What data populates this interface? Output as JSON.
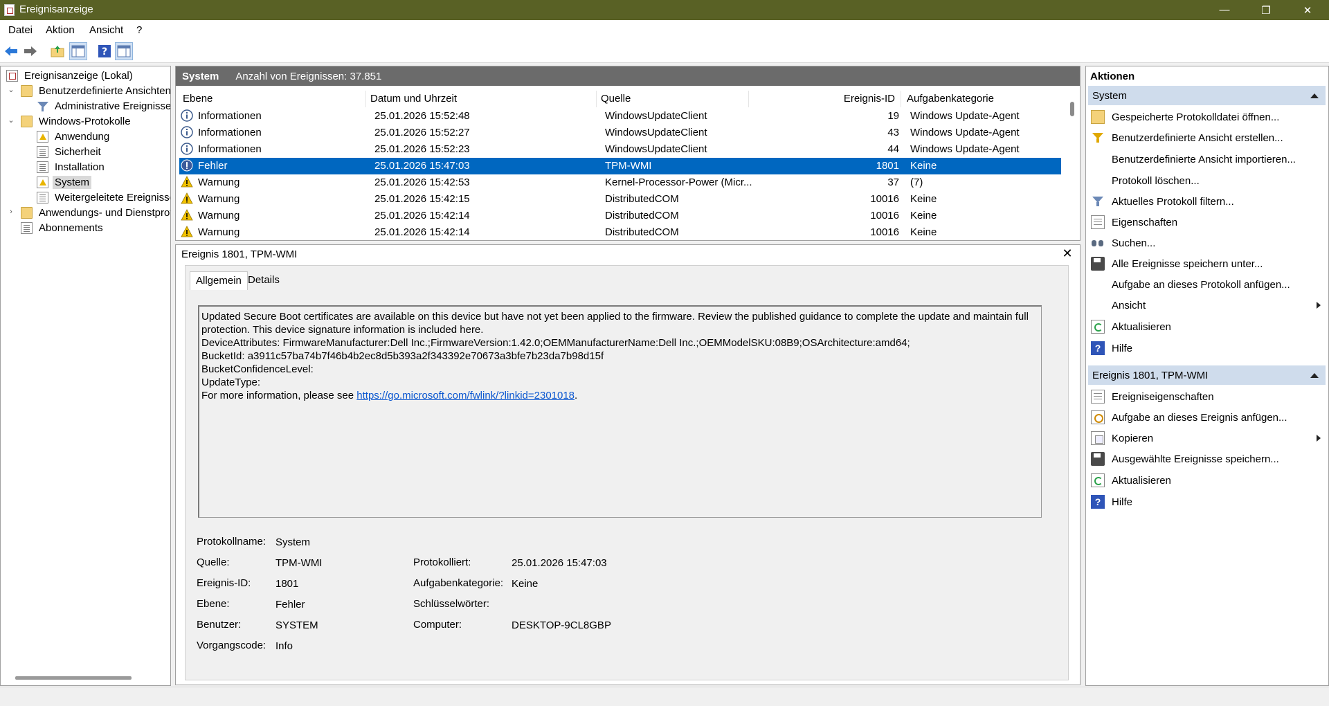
{
  "window": {
    "title": "Ereignisanzeige"
  },
  "menu": [
    "Datei",
    "Aktion",
    "Ansicht",
    "?"
  ],
  "tree": {
    "root": "Ereignisanzeige (Lokal)",
    "custom_views": "Benutzerdefinierte Ansichten",
    "admin_events": "Administrative Ereignisse",
    "windows_logs": "Windows-Protokolle",
    "logs": [
      "Anwendung",
      "Sicherheit",
      "Installation",
      "System",
      "Weitergeleitete Ereignisse"
    ],
    "app_services": "Anwendungs- und Dienstprotokolle",
    "subscriptions": "Abonnements"
  },
  "list": {
    "title": "System",
    "count": "Anzahl von Ereignissen: 37.851",
    "columns": [
      "Ebene",
      "Datum und Uhrzeit",
      "Quelle",
      "Ereignis-ID",
      "Aufgabenkategorie"
    ],
    "rows": [
      {
        "level": "Informationen",
        "icon": "info-icon",
        "date": "25.01.2026 15:52:48",
        "source": "WindowsUpdateClient",
        "id": "19",
        "task": "Windows Update-Agent"
      },
      {
        "level": "Informationen",
        "icon": "info-icon",
        "date": "25.01.2026 15:52:27",
        "source": "WindowsUpdateClient",
        "id": "43",
        "task": "Windows Update-Agent"
      },
      {
        "level": "Informationen",
        "icon": "info-icon",
        "date": "25.01.2026 15:52:23",
        "source": "WindowsUpdateClient",
        "id": "44",
        "task": "Windows Update-Agent"
      },
      {
        "level": "Fehler",
        "icon": "error-icon",
        "date": "25.01.2026 15:47:03",
        "source": "TPM-WMI",
        "id": "1801",
        "task": "Keine"
      },
      {
        "level": "Warnung",
        "icon": "warning-icon",
        "date": "25.01.2026 15:42:53",
        "source": "Kernel-Processor-Power (Micr...",
        "id": "37",
        "task": "(7)"
      },
      {
        "level": "Warnung",
        "icon": "warning-icon",
        "date": "25.01.2026 15:42:15",
        "source": "DistributedCOM",
        "id": "10016",
        "task": "Keine"
      },
      {
        "level": "Warnung",
        "icon": "warning-icon",
        "date": "25.01.2026 15:42:14",
        "source": "DistributedCOM",
        "id": "10016",
        "task": "Keine"
      },
      {
        "level": "Warnung",
        "icon": "warning-icon",
        "date": "25.01.2026 15:42:14",
        "source": "DistributedCOM",
        "id": "10016",
        "task": "Keine"
      }
    ],
    "selected_index": 3
  },
  "detail": {
    "title": "Ereignis 1801, TPM-WMI",
    "tabs": [
      "Allgemein",
      "Details"
    ],
    "message": {
      "line1": "Updated Secure Boot certificates are available on this device but have not yet been applied to the firmware. Review the published guidance to complete the update and maintain full protection. This device signature information is included here.",
      "line2": "DeviceAttributes: FirmwareManufacturer:Dell Inc.;FirmwareVersion:1.42.0;OEMManufacturerName:Dell Inc.;OEMModelSKU:08B9;OSArchitecture:amd64;",
      "line3": "BucketId: a3911c57ba74b7f46b4b2ec8d5b393a2f343392e70673a3bfe7b23da7b98d15f",
      "line4": "BucketConfidenceLevel:",
      "line5": "UpdateType:",
      "line6_prefix": "For more information, please see ",
      "link": "https://go.microsoft.com/fwlink/?linkid=2301018",
      "line6_suffix": "."
    },
    "props": {
      "log_name_label": "Protokollname:",
      "log_name": "System",
      "source_label": "Quelle:",
      "source": "TPM-WMI",
      "logged_label": "Protokolliert:",
      "logged": "25.01.2026 15:47:03",
      "event_id_label": "Ereignis-ID:",
      "event_id": "1801",
      "task_label": "Aufgabenkategorie:",
      "task": "Keine",
      "level_label": "Ebene:",
      "level": "Fehler",
      "keywords_label": "Schlüsselwörter:",
      "keywords": "",
      "user_label": "Benutzer:",
      "user": "SYSTEM",
      "computer_label": "Computer:",
      "computer": "DESKTOP-9CL8GBP",
      "opcode_label": "Vorgangscode:",
      "opcode": "Info"
    }
  },
  "actions": {
    "header": "Aktionen",
    "section1": "System",
    "items1": [
      "Gespeicherte Protokolldatei öffnen...",
      "Benutzerdefinierte Ansicht erstellen...",
      "Benutzerdefinierte Ansicht importieren...",
      "Protokoll löschen...",
      "Aktuelles Protokoll filtern...",
      "Eigenschaften",
      "Suchen...",
      "Alle Ereignisse speichern unter...",
      "Aufgabe an dieses Protokoll anfügen...",
      "Ansicht",
      "Aktualisieren",
      "Hilfe"
    ],
    "section2": "Ereignis 1801, TPM-WMI",
    "items2": [
      "Ereigniseigenschaften",
      "Aufgabe an dieses Ereignis anfügen...",
      "Kopieren",
      "Ausgewählte Ereignisse speichern...",
      "Aktualisieren",
      "Hilfe"
    ]
  },
  "colors": {
    "titlebar": "#596125",
    "selection": "#0067c0",
    "section_header": "#cfdcec"
  }
}
